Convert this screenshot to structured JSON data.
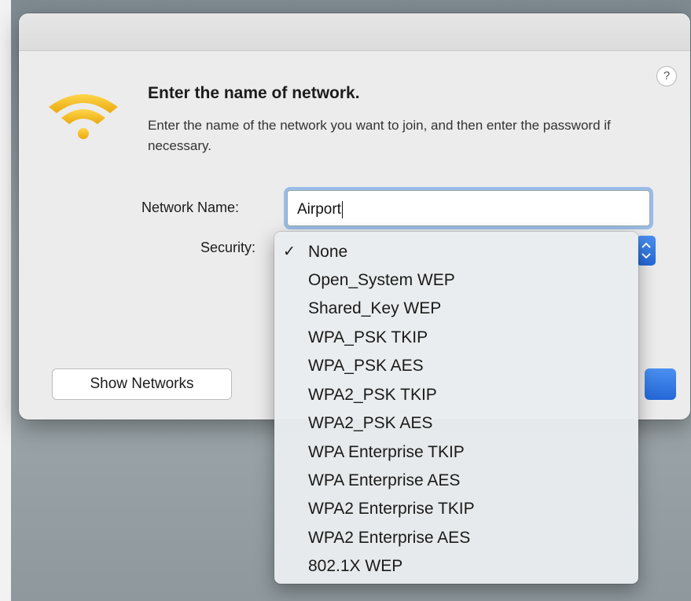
{
  "dialog": {
    "help": "?",
    "heading": "Enter the name of network.",
    "description": "Enter the name of the network you want to join, and then enter the password if necessary.",
    "network_name_label": "Network Name:",
    "network_name_value": "Airport",
    "security_label": "Security:",
    "show_networks_button": "Show Networks"
  },
  "security_menu": {
    "check_glyph": "✓",
    "selected": "None",
    "items": [
      {
        "label": "None"
      },
      {
        "label": "Open_System WEP"
      },
      {
        "label": "Shared_Key WEP"
      },
      {
        "label": "WPA_PSK TKIP"
      },
      {
        "label": "WPA_PSK AES"
      },
      {
        "label": "WPA2_PSK TKIP"
      },
      {
        "label": "WPA2_PSK AES"
      },
      {
        "label": "WPA Enterprise TKIP"
      },
      {
        "label": "WPA Enterprise AES"
      },
      {
        "label": "WPA2 Enterprise TKIP"
      },
      {
        "label": "WPA2 Enterprise AES"
      },
      {
        "label": "802.1X WEP"
      }
    ]
  },
  "icons": {
    "app_icon": "wifi-icon",
    "stepper_icon": "chevron-updown-icon"
  },
  "colors": {
    "accent": "#2f7bea",
    "wifi_yellow": "#f3c22b",
    "dialog_bg": "#ececec"
  }
}
